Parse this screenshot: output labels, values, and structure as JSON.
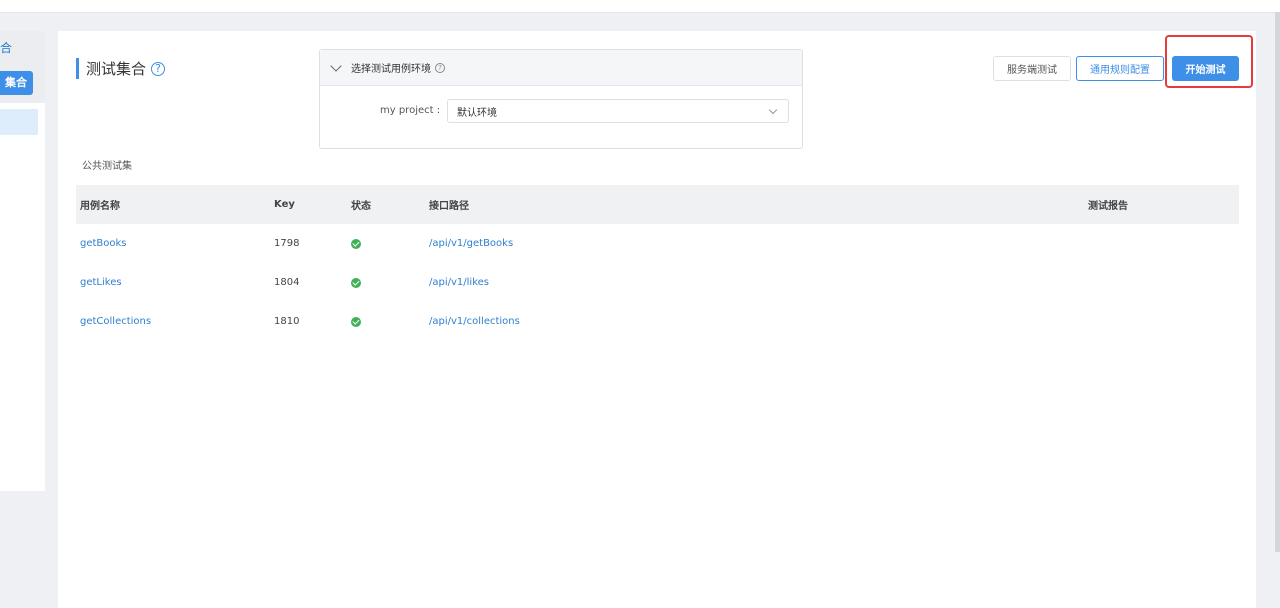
{
  "sidebar": {
    "section_label": "合",
    "active_button": "集合"
  },
  "main": {
    "title": "测试集合",
    "help_icon": "?",
    "env_panel": {
      "header": "选择测试用例环境",
      "help_icon": "?",
      "project_label": "my project :",
      "selected_env": "默认环境"
    },
    "buttons": {
      "server_test": "服务端测试",
      "rule_config": "通用规则配置",
      "start_test": "开始测试"
    },
    "section_label": "公共测试集",
    "table": {
      "headers": [
        "用例名称",
        "Key",
        "状态",
        "接口路径",
        "测试报告"
      ],
      "rows": [
        {
          "name": "getBooks",
          "key": "1798",
          "status": "success",
          "path": "/api/v1/getBooks"
        },
        {
          "name": "getLikes",
          "key": "1804",
          "status": "success",
          "path": "/api/v1/likes"
        },
        {
          "name": "getCollections",
          "key": "1810",
          "status": "success",
          "path": "/api/v1/collections"
        }
      ]
    }
  },
  "colors": {
    "accent": "#3d8fe8",
    "link": "#2f7fcf",
    "success": "#3fb055",
    "highlight": "#e53b3b"
  }
}
